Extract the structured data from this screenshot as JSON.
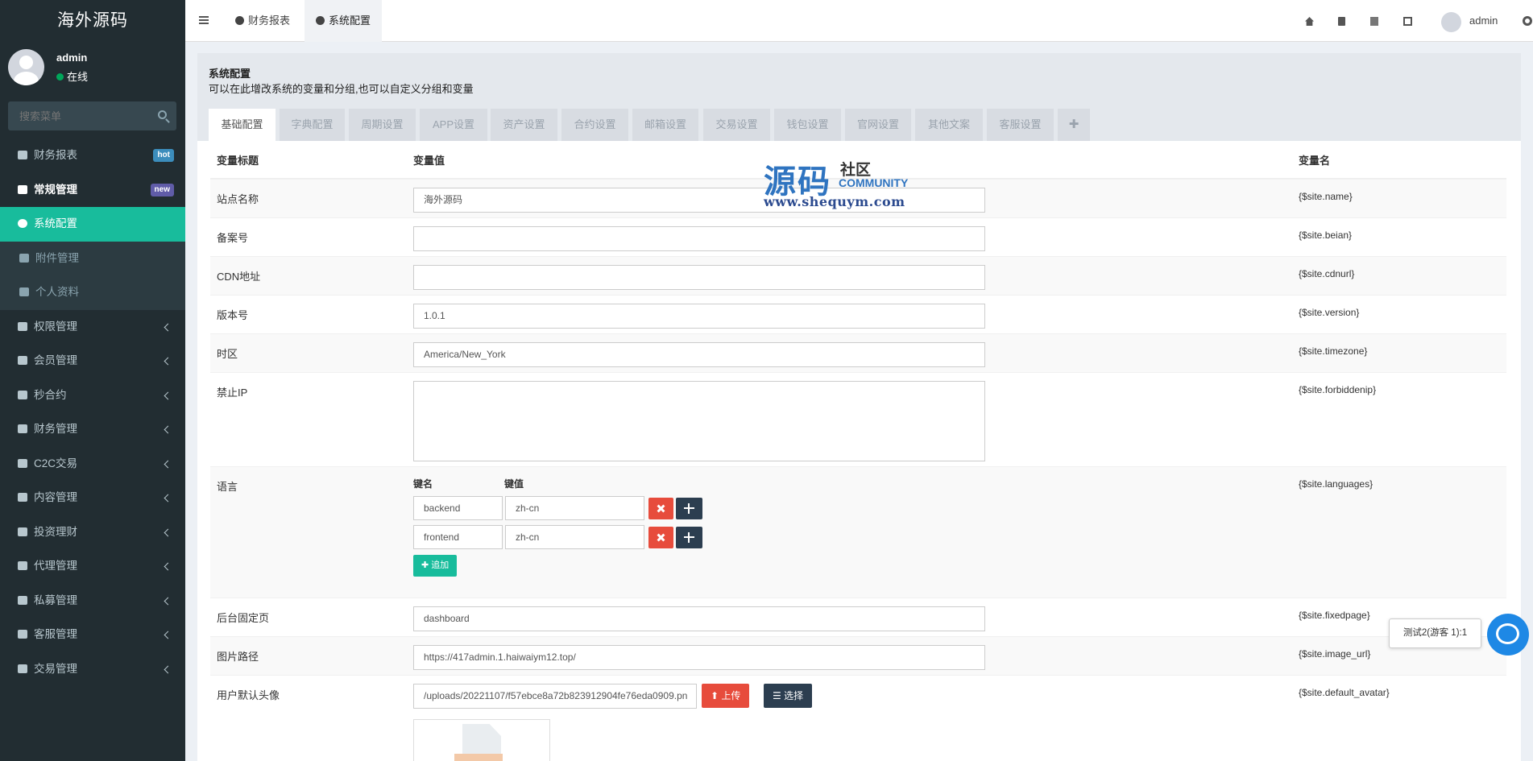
{
  "sidebar": {
    "logo": "海外源码",
    "user": {
      "name": "admin",
      "status": "在线"
    },
    "search_placeholder": "搜索菜单",
    "items": [
      {
        "label": "财务报表",
        "badge": "hot"
      },
      {
        "label": "常规管理",
        "badge": "new"
      },
      {
        "label": "系统配置"
      },
      {
        "label": "附件管理"
      },
      {
        "label": "个人资料"
      },
      {
        "label": "权限管理"
      },
      {
        "label": "会员管理"
      },
      {
        "label": "秒合约"
      },
      {
        "label": "财务管理"
      },
      {
        "label": "C2C交易"
      },
      {
        "label": "内容管理"
      },
      {
        "label": "投资理财"
      },
      {
        "label": "代理管理"
      },
      {
        "label": "私募管理"
      },
      {
        "label": "客服管理"
      },
      {
        "label": "交易管理"
      }
    ]
  },
  "header": {
    "tabs": [
      {
        "label": "财务报表"
      },
      {
        "label": "系统配置"
      }
    ],
    "user": "admin"
  },
  "page": {
    "title": "系统配置",
    "description": "可以在此增改系统的变量和分组,也可以自定义分组和变量",
    "tabs": [
      "基础配置",
      "字典配置",
      "周期设置",
      "APP设置",
      "资产设置",
      "合约设置",
      "邮箱设置",
      "交易设置",
      "钱包设置",
      "官网设置",
      "其他文案",
      "客服设置",
      "✚"
    ]
  },
  "table": {
    "headers": {
      "title": "变量标题",
      "value": "变量值",
      "name": "变量名"
    },
    "rows": [
      {
        "title": "站点名称",
        "value": "海外源码",
        "name": "{$site.name}"
      },
      {
        "title": "备案号",
        "value": "",
        "name": "{$site.beian}"
      },
      {
        "title": "CDN地址",
        "value": "",
        "name": "{$site.cdnurl}"
      },
      {
        "title": "版本号",
        "value": "1.0.1",
        "name": "{$site.version}"
      },
      {
        "title": "时区",
        "value": "America/New_York",
        "name": "{$site.timezone}"
      },
      {
        "title": "禁止IP",
        "value": "",
        "name": "{$site.forbiddenip}"
      },
      {
        "title": "语言",
        "name": "{$site.languages}"
      },
      {
        "title": "后台固定页",
        "value": "dashboard",
        "name": "{$site.fixedpage}"
      },
      {
        "title": "图片路径",
        "value": "https://417admin.1.haiwaiym12.top/",
        "name": "{$site.image_url}"
      },
      {
        "title": "用户默认头像",
        "value": "/uploads/20221107/f57ebce8a72b823912904fe76eda0909.pn",
        "name": "{$site.default_avatar}"
      }
    ],
    "languages": {
      "key_header": "键名",
      "value_header": "键值",
      "pairs": [
        {
          "key": "backend",
          "value": "zh-cn"
        },
        {
          "key": "frontend",
          "value": "zh-cn"
        }
      ],
      "add_label": "✚ 追加"
    },
    "upload_label": "上传",
    "select_label": "选择"
  },
  "watermark": {
    "big": "源码",
    "small": "社区",
    "community": "COMMUNITY",
    "url": "www.shequym.com"
  },
  "chat": {
    "bubble_text": "测试2(游客 1):1"
  },
  "colors": {
    "sidebar_bg": "#222d32",
    "active": "#18bc9c",
    "danger": "#e74c3c",
    "dark": "#2c3e50"
  }
}
